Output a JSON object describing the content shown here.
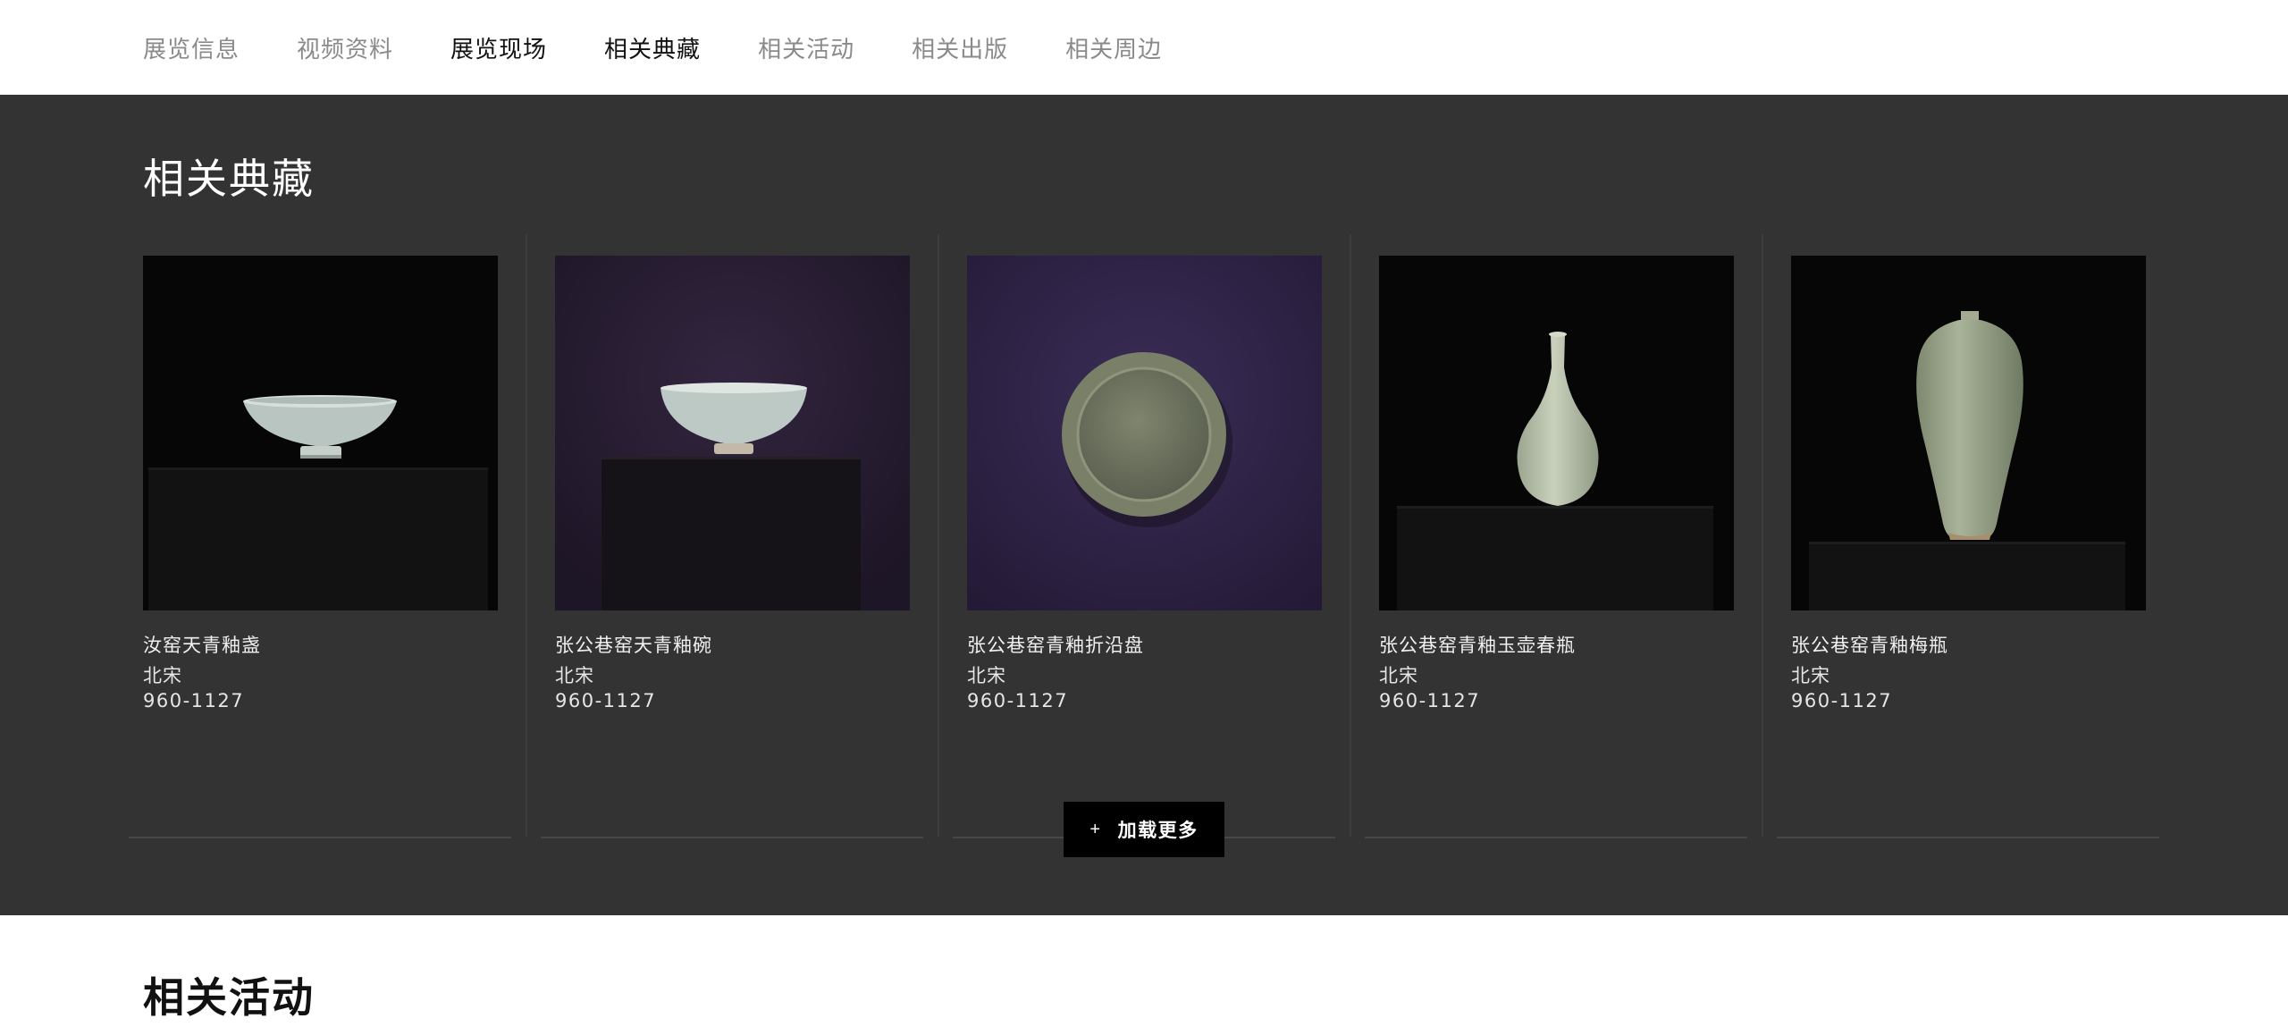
{
  "nav": {
    "items": [
      {
        "label": "展览信息",
        "active": false
      },
      {
        "label": "视频资料",
        "active": false
      },
      {
        "label": "展览现场",
        "active": true
      },
      {
        "label": "相关典藏",
        "active": true
      },
      {
        "label": "相关活动",
        "active": false
      },
      {
        "label": "相关出版",
        "active": false
      },
      {
        "label": "相关周边",
        "active": false
      }
    ]
  },
  "collection": {
    "title": "相关典藏",
    "items": [
      {
        "name": "汝窑天青釉盏",
        "dynasty": "北宋",
        "years": "960-1127",
        "image": "bowl-small-black-bg"
      },
      {
        "name": "张公巷窑天青釉碗",
        "dynasty": "北宋",
        "years": "960-1127",
        "image": "bowl-purple-bg"
      },
      {
        "name": "张公巷窑青釉折沿盘",
        "dynasty": "北宋",
        "years": "960-1127",
        "image": "plate-purple-bg"
      },
      {
        "name": "张公巷窑青釉玉壶春瓶",
        "dynasty": "北宋",
        "years": "960-1127",
        "image": "pear-vase-black-bg"
      },
      {
        "name": "张公巷窑青釉梅瓶",
        "dynasty": "北宋",
        "years": "960-1127",
        "image": "meiping-black-bg"
      }
    ],
    "load_more_icon": "+",
    "load_more_label": "加载更多"
  },
  "activities": {
    "title": "相关活动"
  },
  "colors": {
    "dark_section": "#333333",
    "celadon": "#b9c7b8",
    "purple_bg": "#2b1f3a",
    "button": "#000000"
  }
}
